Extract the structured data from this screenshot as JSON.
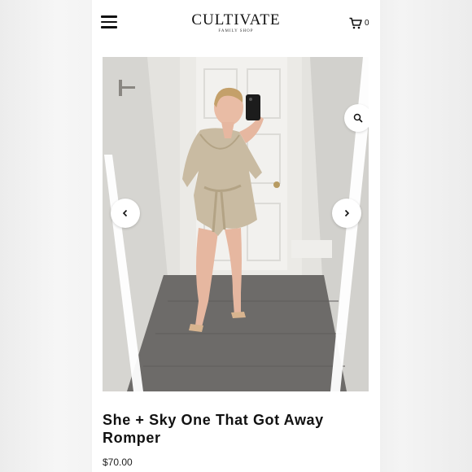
{
  "header": {
    "logo_text": "CULTIVATE",
    "logo_subtext": "FAMILY SHOP",
    "cart_count": "0"
  },
  "icons": {
    "menu": "hamburger-menu-icon",
    "cart": "shopping-cart-icon",
    "zoom": "zoom-magnifier-icon",
    "prev": "chevron-left-icon",
    "next": "chevron-right-icon"
  },
  "product": {
    "image_alt": "Woman taking a mirror selfie wearing a champagne sequin wrap romper",
    "name": "She + Sky One That Got Away Romper",
    "price": "$70.00"
  },
  "colors": {
    "text": "#111111",
    "background": "#ffffff"
  }
}
